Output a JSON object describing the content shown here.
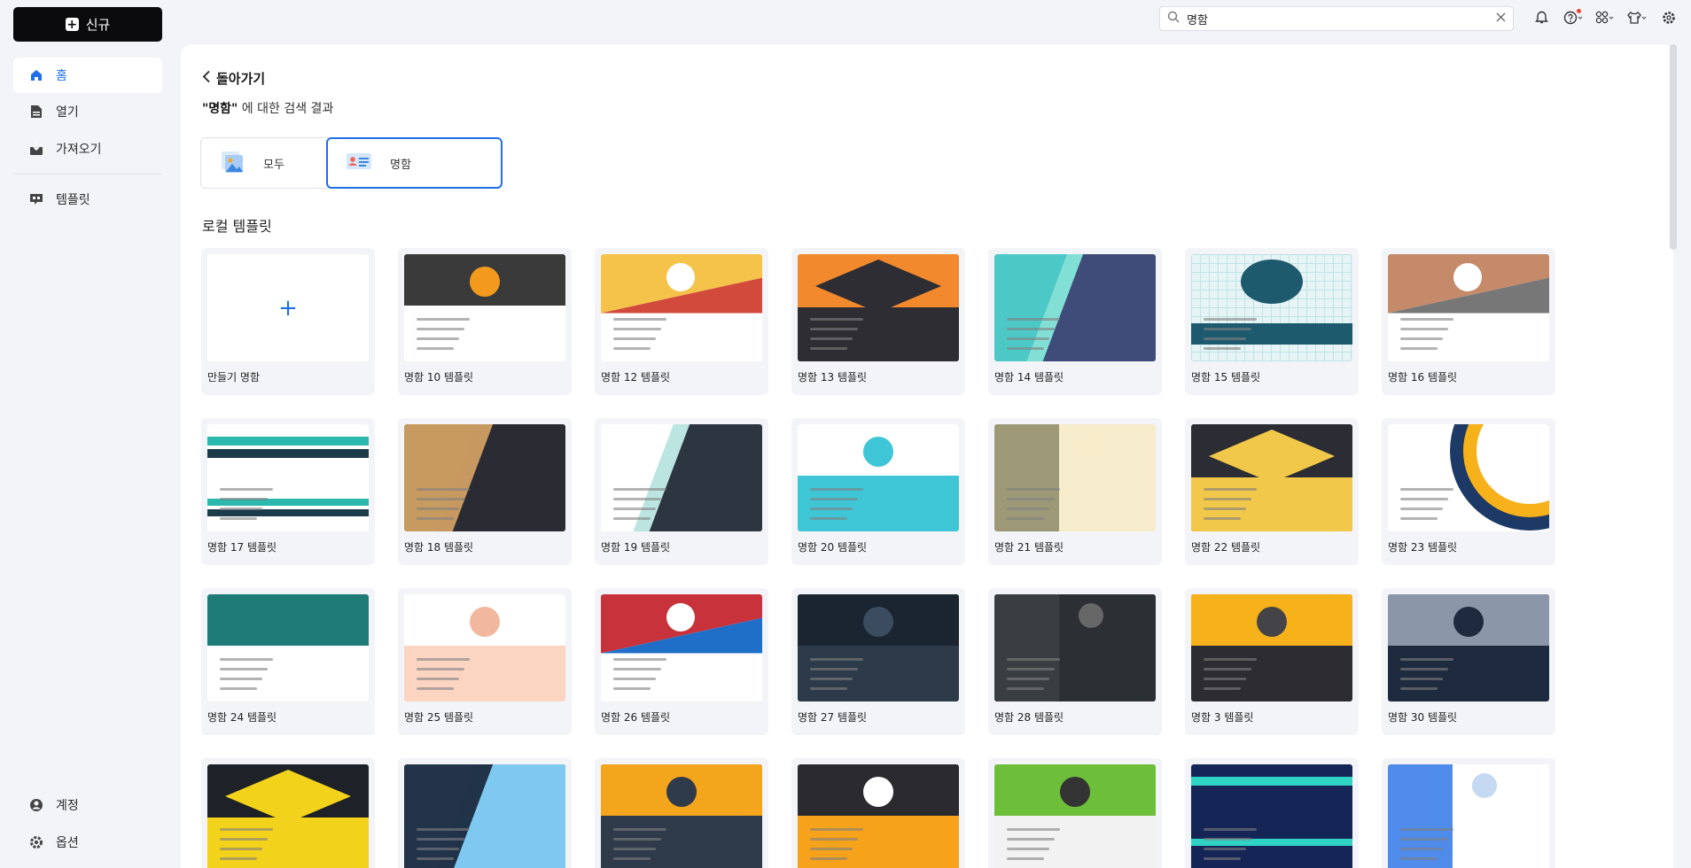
{
  "sidebar": {
    "new_label": "신규",
    "items": [
      {
        "label": "홈",
        "icon": "home-icon",
        "active": true
      },
      {
        "label": "열기",
        "icon": "file-icon",
        "active": false
      },
      {
        "label": "가져오기",
        "icon": "import-icon",
        "active": false
      },
      {
        "label": "템플릿",
        "icon": "template-icon",
        "active": false
      }
    ],
    "bottom": [
      {
        "label": "계정",
        "icon": "account-icon"
      },
      {
        "label": "옵션",
        "icon": "gear-icon"
      }
    ]
  },
  "search": {
    "value": "명함",
    "placeholder": ""
  },
  "main": {
    "back_label": "돌아가기",
    "result_query": "\"명함\"",
    "result_suffix": " 에 대한 검색 결과",
    "filters": [
      {
        "label": "모두",
        "selected": false
      },
      {
        "label": "명함",
        "selected": true
      }
    ],
    "section_title": "로컬 템플릿",
    "blank_card_label": "만들기 명함",
    "templates": [
      {
        "label": "명함 10 템플릿",
        "bg": "#ffffff",
        "accent": "#3a3a3a",
        "accent2": "#f39a1d",
        "style": "top"
      },
      {
        "label": "명함 12 템플릿",
        "bg": "#ffffff",
        "accent": "#f5c34a",
        "accent2": "#d24a3c",
        "style": "tri"
      },
      {
        "label": "명함 13 템플릿",
        "bg": "#f2892c",
        "accent": "#2d2d33",
        "accent2": "#f2892c",
        "style": "diamond"
      },
      {
        "label": "명함 14 템플릿",
        "bg": "#4cc9c6",
        "accent": "#3f4c7a",
        "accent2": "#a6efe0",
        "style": "split"
      },
      {
        "label": "명함 15 템플릿",
        "bg": "#e6f4f5",
        "accent": "#1e5a6e",
        "accent2": "#bfe3e6",
        "style": "grid"
      },
      {
        "label": "명함 16 템플릿",
        "bg": "#ffffff",
        "accent": "#c48a6a",
        "accent2": "#777777",
        "style": "tri"
      },
      {
        "label": "명함 17 템플릿",
        "bg": "#ffffff",
        "accent": "#2bb8ad",
        "accent2": "#1b3b4a",
        "style": "stripes"
      },
      {
        "label": "명함 18 템플릿",
        "bg": "#c79a60",
        "accent": "#2b2b33",
        "accent2": "#c79a60",
        "style": "split"
      },
      {
        "label": "명함 19 템플릿",
        "bg": "#ffffff",
        "accent": "#2d3540",
        "accent2": "#8fd3cf",
        "style": "split"
      },
      {
        "label": "명함 20 템플릿",
        "bg": "#3fc6d6",
        "accent": "#ffffff",
        "accent2": "#3fc6d6",
        "style": "top"
      },
      {
        "label": "명함 21 템플릿",
        "bg": "#f7eccb",
        "accent": "#9d9977",
        "accent2": "#f7eccb",
        "style": "side"
      },
      {
        "label": "명함 22 템플릿",
        "bg": "#2c2c34",
        "accent": "#f2c84a",
        "accent2": "#2c2c34",
        "style": "diamond"
      },
      {
        "label": "명함 23 템플릿",
        "bg": "#ffffff",
        "accent": "#f7b11a",
        "accent2": "#1d3a66",
        "style": "arc"
      },
      {
        "label": "명함 24 템플릿",
        "bg": "#ffffff",
        "accent": "#1f7b78",
        "accent2": "#1f7b78",
        "style": "top"
      },
      {
        "label": "명함 25 템플릿",
        "bg": "#fcd5c2",
        "accent": "#ffffff",
        "accent2": "#f2b89e",
        "style": "top"
      },
      {
        "label": "명함 26 템플릿",
        "bg": "#ffffff",
        "accent": "#c8323a",
        "accent2": "#1f6fc9",
        "style": "tri"
      },
      {
        "label": "명함 27 템플릿",
        "bg": "#2c3a4a",
        "accent": "#1b2532",
        "accent2": "#3a4c5e",
        "style": "top"
      },
      {
        "label": "명함 28 템플릿",
        "bg": "#2c2f33",
        "accent": "#3a3e43",
        "accent2": "#6e6e6e",
        "style": "side"
      },
      {
        "label": "명함 3 템플릿",
        "bg": "#2c2c32",
        "accent": "#f7b11a",
        "accent2": "#444448",
        "style": "top"
      },
      {
        "label": "명함 30 템플릿",
        "bg": "#1e2a3e",
        "accent": "#8b96a8",
        "accent2": "#1e2a3e",
        "style": "top"
      },
      {
        "label": "",
        "bg": "#1e2128",
        "accent": "#f2d21a",
        "accent2": "#1e2128",
        "style": "diamond"
      },
      {
        "label": "",
        "bg": "#22334a",
        "accent": "#7fc8ef",
        "accent2": "#22334a",
        "style": "split"
      },
      {
        "label": "",
        "bg": "#2f3a4a",
        "accent": "#f3a51c",
        "accent2": "#2f3a4a",
        "style": "top"
      },
      {
        "label": "",
        "bg": "#f7a21b",
        "accent": "#2b2b2f",
        "accent2": "#ffffff",
        "style": "top"
      },
      {
        "label": "",
        "bg": "#f2f2f2",
        "accent": "#6dbf3a",
        "accent2": "#333333",
        "style": "top"
      },
      {
        "label": "",
        "bg": "#152556",
        "accent": "#2fd3c4",
        "accent2": "#152556",
        "style": "stripes"
      },
      {
        "label": "",
        "bg": "#ffffff",
        "accent": "#4f8bea",
        "accent2": "#bfd5f2",
        "style": "side"
      }
    ]
  },
  "colors": {
    "accent": "#1f6fe6",
    "sidebar_bg": "#f3f4f8",
    "dark_button": "#0b0b0d"
  }
}
